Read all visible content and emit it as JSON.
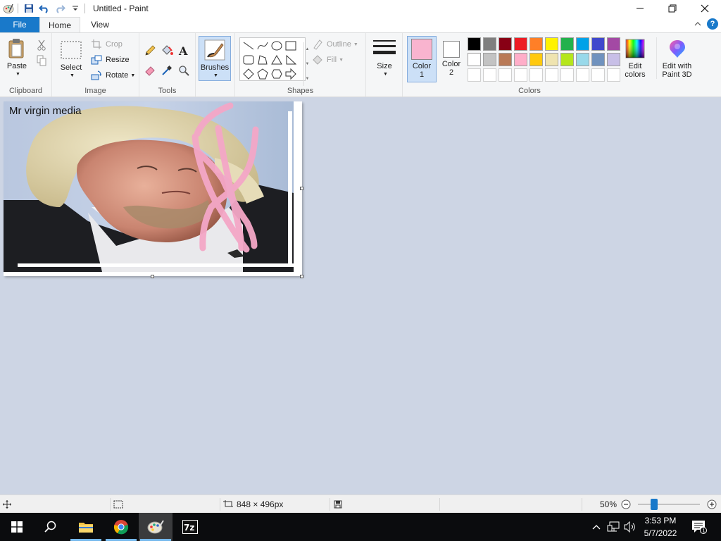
{
  "window": {
    "title": "Untitled - Paint"
  },
  "tabs": {
    "file": "File",
    "home": "Home",
    "view": "View"
  },
  "ribbon": {
    "clipboard": {
      "label": "Clipboard",
      "paste": "Paste"
    },
    "image": {
      "label": "Image",
      "select": "Select",
      "crop": "Crop",
      "resize": "Resize",
      "rotate": "Rotate"
    },
    "tools": {
      "label": "Tools"
    },
    "brushes": {
      "label": "Brushes"
    },
    "shapes": {
      "label": "Shapes",
      "outline": "Outline",
      "fill": "Fill"
    },
    "size": {
      "label": "Size"
    },
    "colors": {
      "label": "Colors",
      "color1_line1": "Color",
      "color1_line2": "1",
      "color2_line1": "Color",
      "color2_line2": "2",
      "edit_line1": "Edit",
      "edit_line2": "colors",
      "paint3d_line1": "Edit with",
      "paint3d_line2": "Paint 3D",
      "color1_value": "#f9b4cf",
      "color2_value": "#ffffff",
      "palette_row1": [
        "#000000",
        "#7f7f7f",
        "#880015",
        "#ed1c24",
        "#ff7f27",
        "#fff200",
        "#22b14c",
        "#00a2e8",
        "#3f48cc",
        "#a349a4"
      ],
      "palette_row2": [
        "#ffffff",
        "#c3c3c3",
        "#b97a57",
        "#ffaec9",
        "#ffc90e",
        "#efe4b0",
        "#b5e61d",
        "#99d9ea",
        "#7092be",
        "#c8bfe7"
      ]
    }
  },
  "canvas": {
    "text": "Mr virgin media",
    "stroke_color": "#f4a7c7"
  },
  "statusbar": {
    "dimensions": "848 × 496px",
    "zoom": "50%"
  },
  "taskbar": {
    "time": "3:53 PM",
    "date": "5/7/2022",
    "notification_count": "1"
  }
}
